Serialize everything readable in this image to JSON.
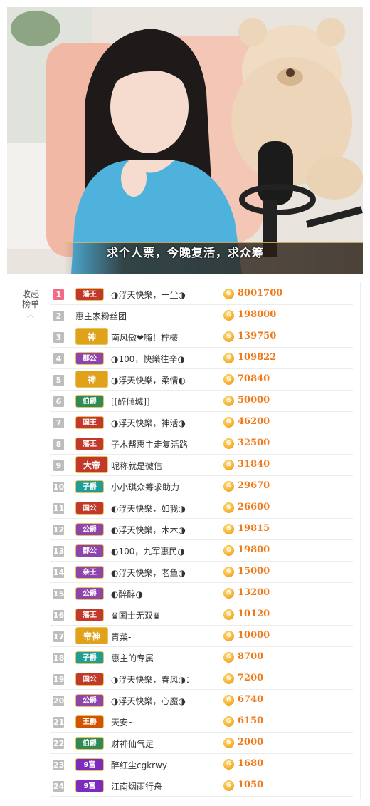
{
  "stream": {
    "subtitle": "求个人票，今晚复活，求众筹"
  },
  "panel": {
    "collapse_label_line1": "收起",
    "collapse_label_line2": "榜单",
    "collapse_icon": "chevron-up-icon",
    "coin_glyph": "6"
  },
  "ranking": [
    {
      "rank": "1",
      "badge": "藩王",
      "badge_color": "#c0392b",
      "name": "◑浮天快樂，一尘◑",
      "score": "8001700"
    },
    {
      "rank": "2",
      "badge": "",
      "badge_color": "",
      "name": "惠主家粉丝团",
      "score": "198000"
    },
    {
      "rank": "3",
      "badge": "神",
      "badge_color": "#e0a21a",
      "name": "南风傲❤嗨！柠檬",
      "score": "139750"
    },
    {
      "rank": "4",
      "badge": "郡公",
      "badge_color": "#8e44ad",
      "name": "◑100，快樂往辛◑",
      "score": "109822"
    },
    {
      "rank": "5",
      "badge": "神",
      "badge_color": "#e0a21a",
      "name": "◑浮天快樂，柔情◐",
      "score": "70840"
    },
    {
      "rank": "6",
      "badge": "伯爵",
      "badge_color": "#2e8b57",
      "name": "[[醉倾城]]",
      "score": "50000"
    },
    {
      "rank": "7",
      "badge": "国王",
      "badge_color": "#c0392b",
      "name": "◑浮天快樂，神活◑",
      "score": "46200"
    },
    {
      "rank": "8",
      "badge": "藩王",
      "badge_color": "#c0392b",
      "name": "子木帮惠主走复活路",
      "score": "32500"
    },
    {
      "rank": "9",
      "badge": "大帝",
      "badge_color": "#c0392b",
      "name": "昵称就是微信",
      "score": "31840"
    },
    {
      "rank": "10",
      "badge": "子爵",
      "badge_color": "#1e9e96",
      "name": "小小琪众筹求助力",
      "score": "29670"
    },
    {
      "rank": "11",
      "badge": "国公",
      "badge_color": "#c0392b",
      "name": "◐浮天快樂，如我◑",
      "score": "26600"
    },
    {
      "rank": "12",
      "badge": "公爵",
      "badge_color": "#8e44ad",
      "name": "◐浮天快樂，木木◑",
      "score": "19815"
    },
    {
      "rank": "13",
      "badge": "郡公",
      "badge_color": "#8e44ad",
      "name": "◐100，九军惠民◑",
      "score": "19800"
    },
    {
      "rank": "14",
      "badge": "亲王",
      "badge_color": "#8e44ad",
      "name": "◐浮天快樂，老鱼◑",
      "score": "15000"
    },
    {
      "rank": "15",
      "badge": "公爵",
      "badge_color": "#8e44ad",
      "name": "◐醉醉◑",
      "score": "13200"
    },
    {
      "rank": "16",
      "badge": "藩王",
      "badge_color": "#c0392b",
      "name": "♛国士无双♛",
      "score": "10120"
    },
    {
      "rank": "17",
      "badge": "帝神",
      "badge_color": "#e0a21a",
      "name": "青菜-",
      "score": "10000"
    },
    {
      "rank": "18",
      "badge": "子爵",
      "badge_color": "#1e9e96",
      "name": "惠主的专属",
      "score": "8700"
    },
    {
      "rank": "19",
      "badge": "国公",
      "badge_color": "#c0392b",
      "name": "◑浮天快樂，春风◑：",
      "score": "7200"
    },
    {
      "rank": "20",
      "badge": "公爵",
      "badge_color": "#8e44ad",
      "name": "◑浮天快樂，心魔◑",
      "score": "6740"
    },
    {
      "rank": "21",
      "badge": "王爵",
      "badge_color": "#d35400",
      "name": "天安~",
      "score": "6150"
    },
    {
      "rank": "22",
      "badge": "伯爵",
      "badge_color": "#2e8b57",
      "name": "财神仙气足",
      "score": "2000"
    },
    {
      "rank": "23",
      "badge": "9富",
      "badge_color": "#7b2cbf",
      "name": "醉红尘cgkrwy",
      "score": "1680"
    },
    {
      "rank": "24",
      "badge": "9富",
      "badge_color": "#7b2cbf",
      "name": "江南烟雨行舟",
      "score": "1050"
    }
  ]
}
